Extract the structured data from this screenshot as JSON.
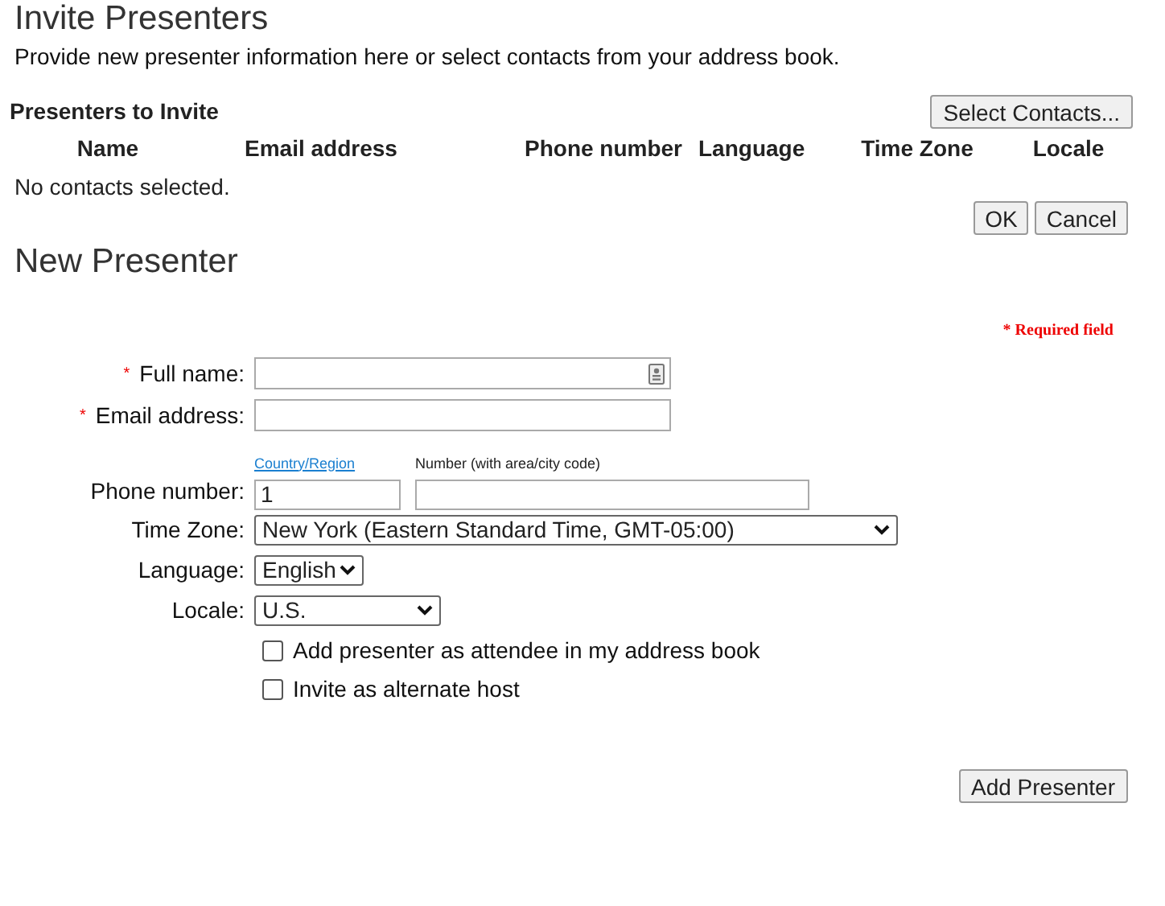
{
  "title": "Invite Presenters",
  "intro": "Provide new presenter information here or select contacts from your address book.",
  "presenters": {
    "heading": "Presenters to Invite",
    "select_button": "Select Contacts...",
    "columns": [
      "Name",
      "Email address",
      "Phone number",
      "Language",
      "Time Zone",
      "Locale"
    ],
    "empty_text": "No contacts selected.",
    "buttons": [
      "OK",
      "Cancel"
    ]
  },
  "new_presenter": {
    "heading": "New Presenter",
    "required_note": "* Required field",
    "fields": [
      {
        "kind": "text",
        "label": "Full name:",
        "required_mark": "*",
        "contact_icon": true
      },
      {
        "kind": "text",
        "label": "Email address:",
        "required_mark": "*"
      },
      {
        "kind": "phone",
        "label": "Phone number:",
        "country_label": "Country/Region",
        "number_label": "Number (with area/city code)",
        "country_value": "1"
      },
      {
        "kind": "select",
        "label": "Time Zone:",
        "value": "New York (Eastern Standard Time, GMT-05:00)"
      },
      {
        "kind": "select",
        "label": "Language:",
        "value": "English"
      },
      {
        "kind": "select",
        "label": "Locale:",
        "value": "U.S."
      },
      {
        "kind": "checkbox",
        "label": "Add presenter as attendee in my address book",
        "checked": false
      },
      {
        "kind": "checkbox",
        "label": "Invite as alternate host",
        "checked": false
      }
    ],
    "submit": "Add Presenter"
  }
}
